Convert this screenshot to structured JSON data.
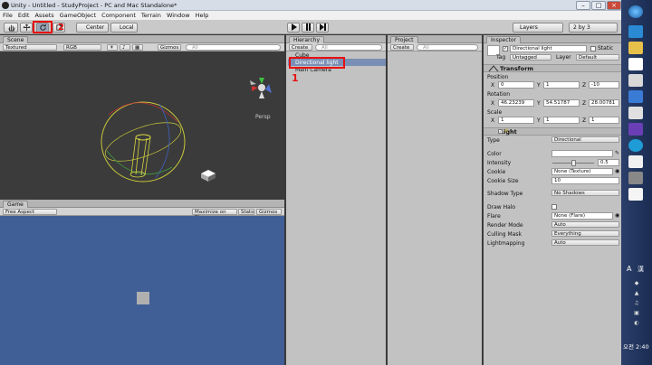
{
  "window": {
    "title": "Unity - Untitled - StudyProject - PC and Mac Standalone*",
    "controls": [
      "–",
      "□",
      "×"
    ]
  },
  "menu": [
    "File",
    "Edit",
    "Assets",
    "GameObject",
    "Component",
    "Terrain",
    "Window",
    "Help"
  ],
  "toolbar": {
    "pivot": "Center",
    "space": "Local",
    "layers": "Layers",
    "layout": "2 by 3",
    "step_number": "2"
  },
  "scene": {
    "tab": "Scene",
    "shading": "Textured",
    "render_mode": "RGB",
    "gizmos": "Gizmos",
    "search": "All",
    "persp": "Persp"
  },
  "game": {
    "tab": "Game",
    "aspect": "Free Aspect",
    "maximize": "Maximize on Play",
    "stats": "Stats",
    "gizmos": "Gizmos"
  },
  "hierarchy": {
    "tab": "Hierarchy",
    "create": "Create",
    "search": "All",
    "items": [
      "Cube",
      "Directional light",
      "Main Camera"
    ],
    "step_number": "1"
  },
  "project": {
    "tab": "Project",
    "create": "Create",
    "search": "All"
  },
  "inspector": {
    "tab": "Inspector",
    "object_name": "Directional light",
    "static": "Static",
    "tag_label": "Tag",
    "tag": "Untagged",
    "layer_label": "Layer",
    "layer": "Default",
    "transform": {
      "title": "Transform",
      "position_label": "Position",
      "position": [
        "0",
        "1",
        "-10"
      ],
      "rotation_label": "Rotation",
      "rotation": [
        "46.23239",
        "54.51787",
        "28.00781"
      ],
      "scale_label": "Scale",
      "scale": [
        "1",
        "1",
        "1"
      ],
      "axes": [
        "X",
        "Y",
        "Z"
      ]
    },
    "light": {
      "title": "Light",
      "type_label": "Type",
      "type": "Directional",
      "color_label": "Color",
      "intensity_label": "Intensity",
      "intensity": "0.5",
      "intensity_fraction": 0.5,
      "cookie_label": "Cookie",
      "cookie": "None (Texture)",
      "cookie_size_label": "Cookie Size",
      "cookie_size": "10",
      "shadow_label": "Shadow Type",
      "shadow": "No Shadows",
      "halo_label": "Draw Halo",
      "flare_label": "Flare",
      "flare": "None (Flare)",
      "render_mode_label": "Render Mode",
      "render_mode": "Auto",
      "culling_label": "Culling Mask",
      "culling": "Everything",
      "lightmapping_label": "Lightmapping",
      "lightmapping": "Auto"
    }
  },
  "taskbar": {
    "lang": "A",
    "ime": "漢",
    "time": "오전 2:40"
  },
  "colors": {
    "scene_bg": "#3b3b3b",
    "game_bg": "#3f5f96",
    "highlight": "#7a8fb5",
    "annotation": "#e81010"
  }
}
